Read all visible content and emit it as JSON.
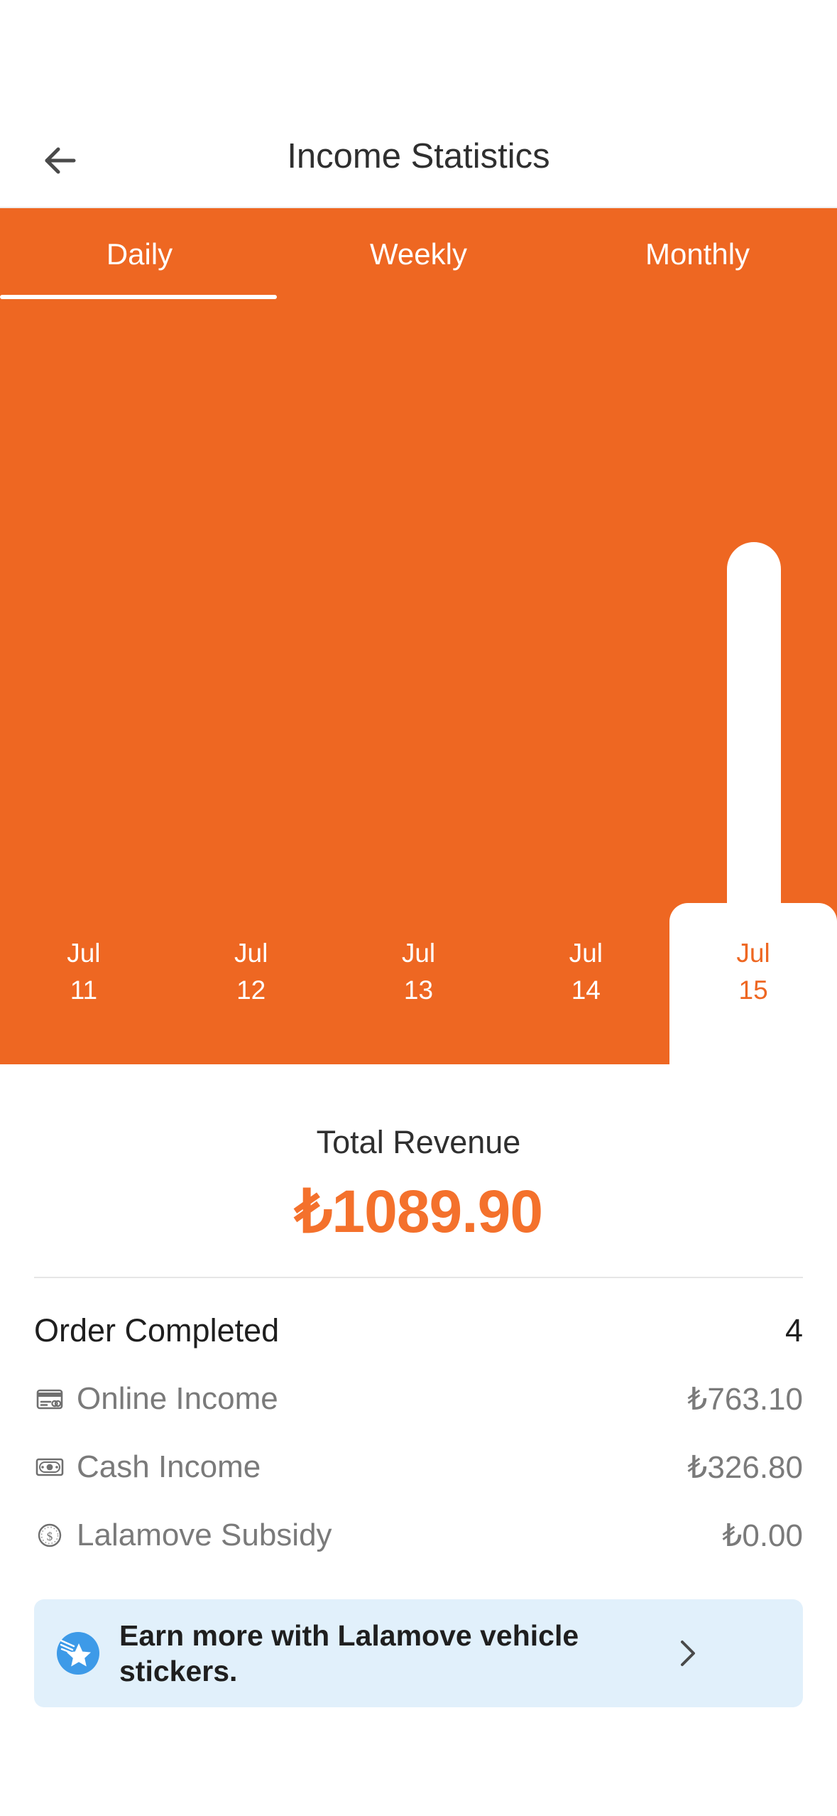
{
  "header": {
    "title": "Income Statistics",
    "back_icon": "arrow-left-icon"
  },
  "tabs": [
    {
      "label": "Daily",
      "active": true
    },
    {
      "label": "Weekly",
      "active": false
    },
    {
      "label": "Monthly",
      "active": false
    }
  ],
  "chart_data": {
    "type": "bar",
    "title": "Daily Income",
    "categories": [
      "Jul\n11",
      "Jul\n12",
      "Jul\n13",
      "Jul\n14",
      "Jul\n15"
    ],
    "tick_labels": [
      {
        "month": "Jul",
        "day": "11"
      },
      {
        "month": "Jul",
        "day": "12"
      },
      {
        "month": "Jul",
        "day": "13"
      },
      {
        "month": "Jul",
        "day": "14"
      },
      {
        "month": "Jul",
        "day": "15"
      }
    ],
    "values": [
      0,
      0,
      0,
      0,
      1089.9
    ],
    "selected_index": 4,
    "bar_color": "#ffffff",
    "plot_background": "#ee6722",
    "grid": false,
    "xlabel": "",
    "ylabel": "",
    "ylim": [
      0,
      1089.9
    ]
  },
  "summary": {
    "total_label": "Total Revenue",
    "total_value": "₺1089.90"
  },
  "breakdown": {
    "order_completed_label": "Order Completed",
    "order_completed_value": "4",
    "rows": [
      {
        "icon": "credit-card-icon",
        "label": "Online Income",
        "value": "₺763.10"
      },
      {
        "icon": "banknote-icon",
        "label": "Cash Income",
        "value": "₺326.80"
      },
      {
        "icon": "coin-dollar-icon",
        "label": "Lalamove Subsidy",
        "value": "₺0.00"
      }
    ]
  },
  "banner": {
    "icon": "shooting-star-icon",
    "text": "Earn more with Lalamove vehicle stickers.",
    "chevron": "chevron-right-icon"
  },
  "colors": {
    "brand_orange": "#ee6722",
    "accent_orange": "#f4712c",
    "banner_blue_bg": "#e1f0fb",
    "banner_icon_blue": "#3d9ae8",
    "muted_text": "#7a7a7a"
  }
}
